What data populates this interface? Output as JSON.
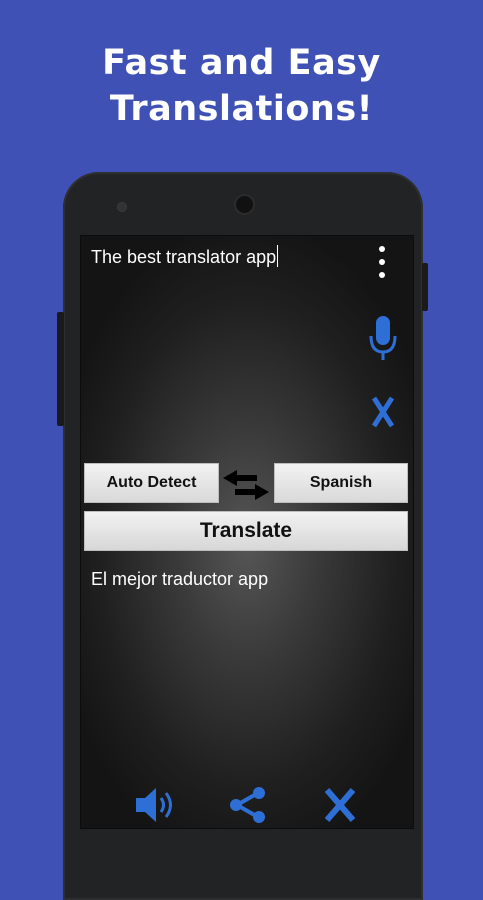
{
  "headline": {
    "line1": "Fast and Easy",
    "line2": "Translations!"
  },
  "app": {
    "input_text": "The best translator app",
    "source_language": "Auto Detect",
    "target_language": "Spanish",
    "translate_label": "Translate",
    "output_text": "El mejor traductor app"
  },
  "icons": {
    "menu": "more-vert-icon",
    "mic": "microphone-icon",
    "clear_input": "close-icon",
    "swap": "swap-arrows-icon",
    "speak": "speaker-icon",
    "share": "share-icon",
    "clear_output": "close-icon"
  },
  "colors": {
    "background": "#3f51b5",
    "accent_icon": "#2e6fd6"
  }
}
